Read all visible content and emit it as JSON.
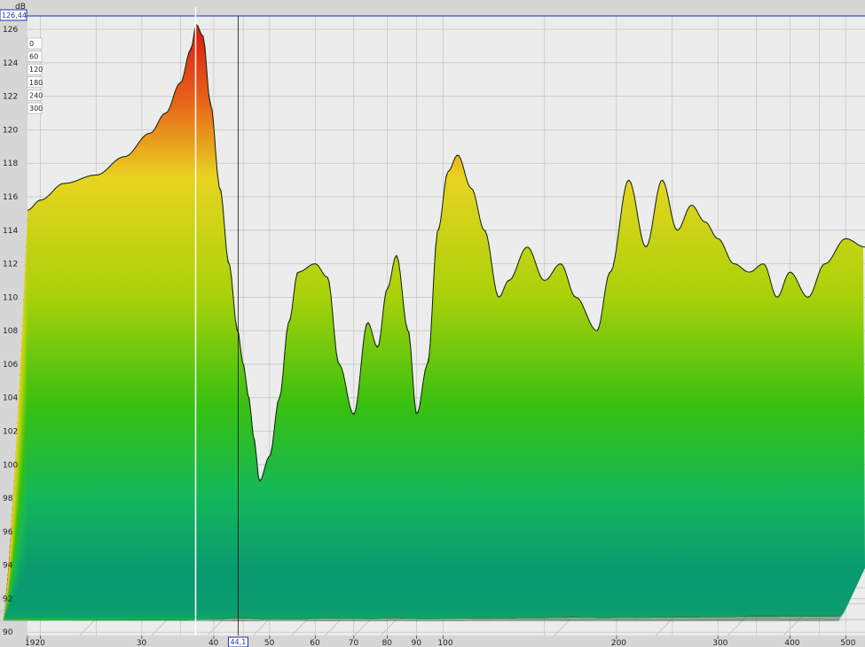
{
  "chart_data": {
    "type": "waterfall",
    "title": "",
    "xlabel": "",
    "ylabel": "dB",
    "x_scale": "log",
    "xlim": [
      19,
      540
    ],
    "ylim": [
      89.8,
      126.8
    ],
    "x_ticks": [
      19,
      20,
      30,
      40,
      50,
      60,
      70,
      80,
      90,
      100,
      200,
      300,
      400,
      500
    ],
    "y_ticks": [
      90,
      92,
      94,
      96,
      98,
      100,
      102,
      104,
      106,
      108,
      110,
      112,
      114,
      116,
      118,
      120,
      122,
      124,
      126
    ],
    "time_labels": [
      "0",
      "60",
      "120",
      "180",
      "240",
      "300"
    ],
    "grid": true,
    "cursor": {
      "x_label": "44,1",
      "y_label": "126,44"
    },
    "front_series": {
      "name": "",
      "points": [
        [
          19,
          115.2
        ],
        [
          20,
          115.8
        ],
        [
          22,
          116.8
        ],
        [
          25,
          117.3
        ],
        [
          28,
          118.4
        ],
        [
          31,
          119.8
        ],
        [
          33,
          121.0
        ],
        [
          35,
          122.8
        ],
        [
          36.5,
          124.8
        ],
        [
          37.3,
          126.3
        ],
        [
          38.3,
          125.6
        ],
        [
          39.5,
          121.5
        ],
        [
          41,
          116.5
        ],
        [
          42.5,
          112.0
        ],
        [
          44,
          108.0
        ],
        [
          45,
          106.0
        ],
        [
          46,
          104.0
        ],
        [
          47,
          101.5
        ],
        [
          48,
          99.0
        ],
        [
          50,
          100.5
        ],
        [
          52,
          104.0
        ],
        [
          54,
          108.5
        ],
        [
          56,
          111.5
        ],
        [
          60,
          112.0
        ],
        [
          63,
          111.2
        ],
        [
          66,
          106.0
        ],
        [
          70,
          103.0
        ],
        [
          74,
          108.5
        ],
        [
          77,
          107.0
        ],
        [
          80,
          110.5
        ],
        [
          83,
          112.5
        ],
        [
          87,
          108.0
        ],
        [
          90,
          103.0
        ],
        [
          94,
          106.0
        ],
        [
          98,
          114.0
        ],
        [
          102,
          117.5
        ],
        [
          106,
          118.5
        ],
        [
          112,
          116.5
        ],
        [
          118,
          114.0
        ],
        [
          125,
          110.0
        ],
        [
          130,
          111.0
        ],
        [
          140,
          113.0
        ],
        [
          150,
          111.0
        ],
        [
          160,
          112.0
        ],
        [
          170,
          110.0
        ],
        [
          185,
          108.0
        ],
        [
          195,
          111.5
        ],
        [
          210,
          117.0
        ],
        [
          225,
          113.0
        ],
        [
          240,
          117.0
        ],
        [
          255,
          114.0
        ],
        [
          270,
          115.5
        ],
        [
          285,
          114.5
        ],
        [
          300,
          113.5
        ],
        [
          320,
          112.0
        ],
        [
          340,
          111.5
        ],
        [
          360,
          112.0
        ],
        [
          380,
          110.0
        ],
        [
          400,
          111.5
        ],
        [
          430,
          110.0
        ],
        [
          460,
          112.0
        ],
        [
          500,
          113.5
        ],
        [
          540,
          113.0
        ]
      ]
    }
  }
}
